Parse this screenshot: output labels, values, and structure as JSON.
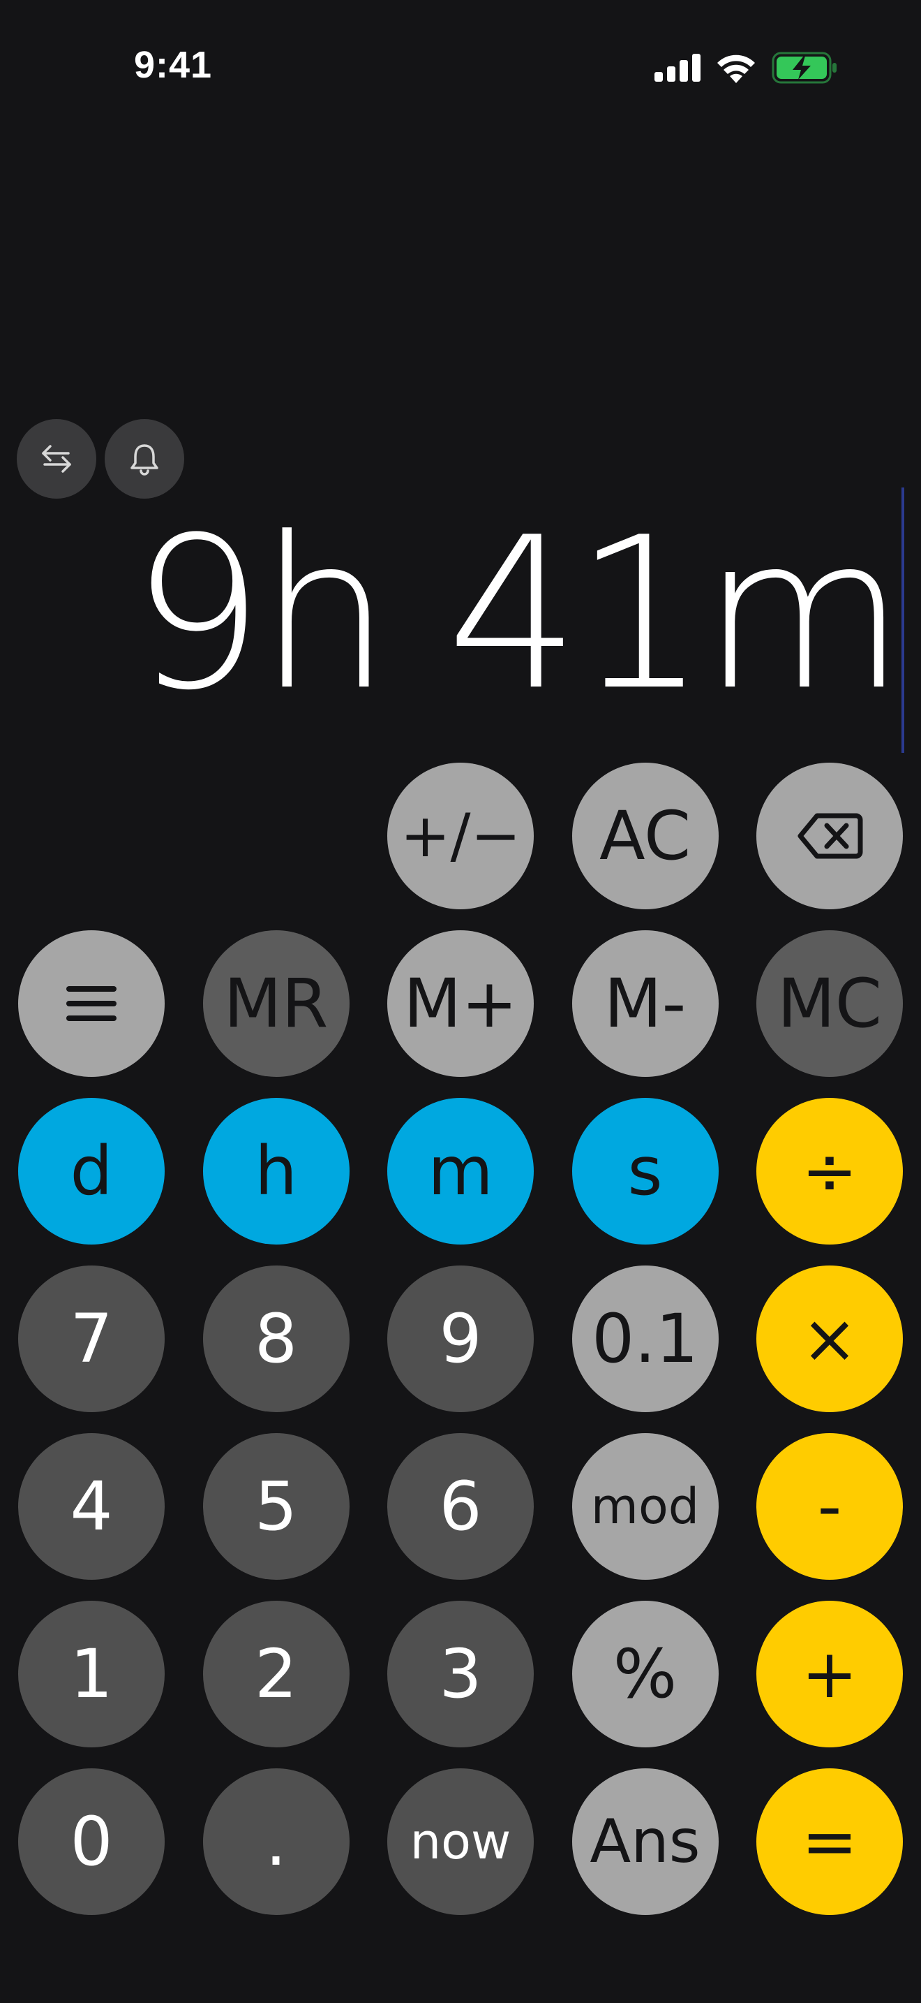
{
  "status_bar": {
    "time": "9:41",
    "icons": [
      "cellular-signal-icon",
      "wifi-icon",
      "battery-charging-icon"
    ],
    "battery_color": "#34c759"
  },
  "tools": [
    {
      "name": "swap-button",
      "icon": "swap-arrows-icon"
    },
    {
      "name": "reminder-button",
      "icon": "bell-icon"
    }
  ],
  "display": {
    "value": "9h 41m"
  },
  "colors": {
    "background": "#141416",
    "function_key": "#a6a6a6",
    "digit_key": "#505050",
    "unit_key": "#00a8e0",
    "operator_key": "#ffcc00"
  },
  "keypad": {
    "row1": {
      "plus_minus": "+/−",
      "clear": "AC",
      "backspace_icon": "backspace-icon"
    },
    "row2": {
      "menu_icon": "menu-icon",
      "mr": "MR",
      "m_plus": "M+",
      "m_minus": "M-",
      "mc": "MC"
    },
    "row3": {
      "days": "d",
      "hours": "h",
      "minutes": "m",
      "seconds": "s",
      "divide": "÷"
    },
    "row4": {
      "seven": "7",
      "eight": "8",
      "nine": "9",
      "tenth": "0.1",
      "multiply": "×"
    },
    "row5": {
      "four": "4",
      "five": "5",
      "six": "6",
      "mod": "mod",
      "subtract": "-"
    },
    "row6": {
      "one": "1",
      "two": "2",
      "three": "3",
      "percent": "%",
      "add": "+"
    },
    "row7": {
      "zero": "0",
      "decimal": ".",
      "now": "now",
      "ans": "Ans",
      "equals": "="
    }
  }
}
